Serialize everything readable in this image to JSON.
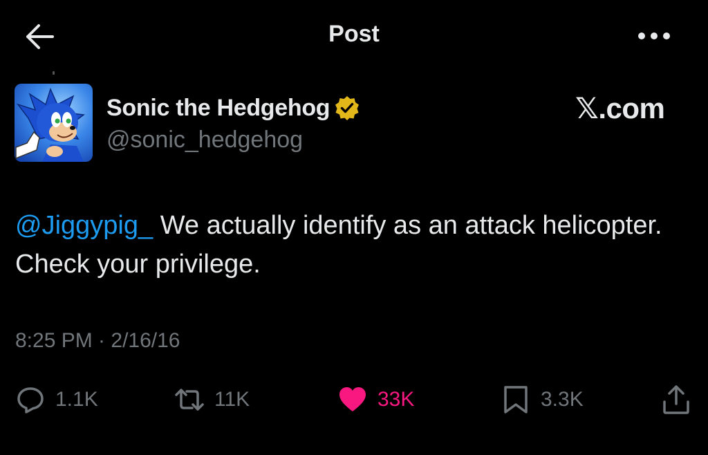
{
  "header": {
    "title": "Post",
    "back_icon": "arrow-left-icon",
    "more_icon": "more-horizontal-icon"
  },
  "author": {
    "display_name": "Sonic the Hedgehog",
    "handle": "@sonic_hedgehog",
    "verified": true,
    "verified_color": "#e2b719",
    "avatar_icon": "avatar-image"
  },
  "site_mark": "𝕏.com",
  "tweet": {
    "mention": "@Jiggypig_",
    "text": " We actually identify as an attack helicopter. Check your privilege.",
    "timestamp": "8:25 PM · 2/16/16"
  },
  "actions": {
    "reply": {
      "icon": "reply-icon",
      "count": "1.1K"
    },
    "repost": {
      "icon": "repost-icon",
      "count": "11K"
    },
    "like": {
      "icon": "heart-icon",
      "count": "33K",
      "liked": true
    },
    "bookmark": {
      "icon": "bookmark-icon",
      "count": "3.3K"
    },
    "share": {
      "icon": "share-icon"
    }
  },
  "colors": {
    "background": "#000000",
    "primary_text": "#e7e9ea",
    "secondary_text": "#71767b",
    "link": "#1d9bf0",
    "like": "#f91880"
  }
}
